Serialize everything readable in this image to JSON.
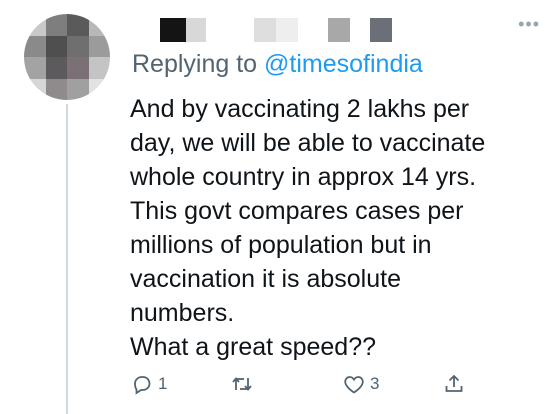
{
  "tweet": {
    "replying_prefix": "Replying to ",
    "replying_handle": "@timesofindia",
    "text_lines": [
      "And by vaccinating 2 lakhs per",
      "day, we will be able to vaccinate",
      "whole country in approx 14 yrs.",
      "This govt compares cases per",
      "millions of population but in",
      "vaccination it is absolute",
      "numbers.",
      "What a great speed??"
    ]
  },
  "actions": {
    "reply_count": "1",
    "retweet_count": "",
    "like_count": "3"
  },
  "icons": {
    "more": "more-icon",
    "reply": "reply-icon",
    "retweet": "retweet-icon",
    "like": "heart-icon",
    "share": "share-icon"
  },
  "colors": {
    "link": "#1d9bf0",
    "secondary_text": "#536471",
    "primary_text": "#0f1419"
  }
}
